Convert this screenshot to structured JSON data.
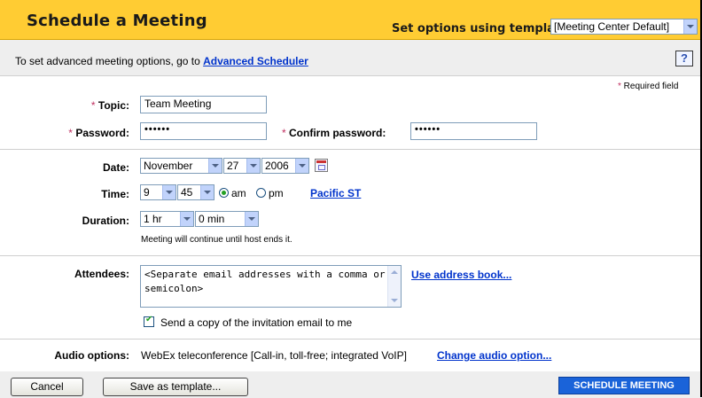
{
  "header": {
    "title": "Schedule a Meeting",
    "template_label": "Set options using template:",
    "template_value": "[Meeting Center Default]"
  },
  "infobar": {
    "text": "To set advanced meeting options, go to ",
    "link": "Advanced Scheduler",
    "help_icon": "?"
  },
  "required_note": "Required field",
  "form": {
    "topic_label": "Topic:",
    "topic_value": "Team Meeting",
    "password_label": "Password:",
    "password_value": "••••••",
    "confirm_label": "Confirm password:",
    "confirm_value": "••••••",
    "date_label": "Date:",
    "date_month": "November",
    "date_day": "27",
    "date_year": "2006",
    "time_label": "Time:",
    "time_hour": "9",
    "time_minute": "45",
    "am_label": "am",
    "pm_label": "pm",
    "am_selected": true,
    "timezone_link": "Pacific ST",
    "duration_label": "Duration:",
    "duration_hr": "1 hr",
    "duration_min": "0 min",
    "duration_note": "Meeting will continue until host ends it.",
    "attendees_label": "Attendees:",
    "attendees_placeholder": "<Separate email addresses with a comma or semicolon>",
    "address_book_link": "Use address book...",
    "send_copy_label": "Send a copy of the invitation email to me",
    "send_copy_checked": true,
    "audio_label": "Audio options:",
    "audio_value": "WebEx teleconference [Call-in, toll-free; integrated VoIP]",
    "audio_link": "Change audio option..."
  },
  "footer": {
    "cancel": "Cancel",
    "save_template": "Save as template...",
    "schedule": "SCHEDULE MEETING"
  },
  "colors": {
    "header_bg": "#ffcc33",
    "link": "#0033cc",
    "primary_button": "#1a63d9",
    "required_star": "#c03060"
  }
}
